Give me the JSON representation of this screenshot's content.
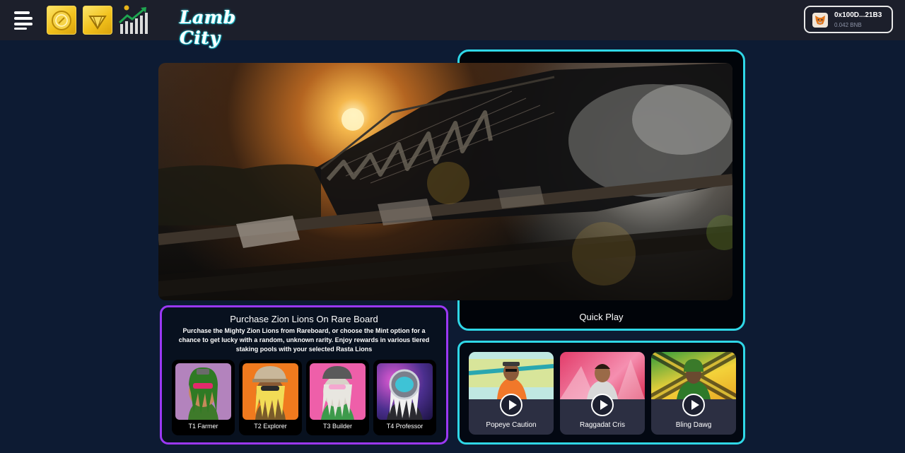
{
  "header": {
    "logo_text": "Lamb City",
    "menu_icon": "hamburger-menu-icon",
    "nav_tokens": [
      {
        "icon": "gold-coin-token-icon"
      },
      {
        "icon": "gold-diamond-token-icon"
      },
      {
        "icon": "market-chart-icon"
      }
    ],
    "wallet": {
      "icon": "metamask-fox-icon",
      "address": "0x100D...21B3",
      "balance": "0.042 BNB"
    }
  },
  "hero": {
    "image": "steam-train-sunset-video",
    "quick_play_label": "Quick Play"
  },
  "purchase_panel": {
    "title": "Purchase Zion Lions On Rare Board",
    "description": "Purchase the Mighty Zion Lions from Rareboard, or choose the Mint option for a chance to get lucky with a random, unknown rarity. Enjoy rewards in various tiered staking pools with your selected Rasta Lions",
    "lions": [
      {
        "label": "T1 Farmer",
        "bg": "#b383bd"
      },
      {
        "label": "T2 Explorer",
        "bg": "#f07a1e"
      },
      {
        "label": "T3 Builder",
        "bg": "#ee5fa9"
      },
      {
        "label": "T4 Professor",
        "bg": "#4b2f8e"
      }
    ]
  },
  "video_panel": {
    "videos": [
      {
        "label": "Popeye Caution"
      },
      {
        "label": "Raggadat Cris"
      },
      {
        "label": "Bling Dawg"
      }
    ]
  },
  "colors": {
    "page_bg": "#0d1b33",
    "topbar_bg": "#1c1f2b",
    "accent_cyan": "#2fd7e7",
    "accent_purple": "#9b38f5"
  }
}
